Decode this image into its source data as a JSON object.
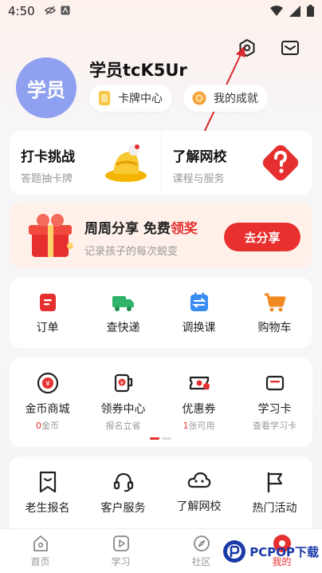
{
  "status_bar": {
    "time": "4:50"
  },
  "profile": {
    "avatar_text": "学员",
    "username": "学员tcK5Ur",
    "pills": [
      {
        "label": "卡牌中心",
        "icon": "card-icon"
      },
      {
        "label": "我的成就",
        "icon": "medal-icon"
      }
    ]
  },
  "header_icons": [
    "settings-icon",
    "message-icon"
  ],
  "promo": [
    {
      "title": "打卡挑战",
      "subtitle": "答题抽卡牌"
    },
    {
      "title": "了解网校",
      "subtitle": "课程与服务"
    }
  ],
  "share": {
    "title_part1": "周周分享 免费",
    "title_highlight": "领奖",
    "subtitle": "记录孩子的每次蜕变",
    "button": "去分享"
  },
  "orders_row": [
    {
      "label": "订单",
      "icon": "order-icon"
    },
    {
      "label": "查快递",
      "icon": "truck-icon"
    },
    {
      "label": "调换课",
      "icon": "swap-course-icon"
    },
    {
      "label": "购物车",
      "icon": "cart-icon"
    }
  ],
  "wallet_row": [
    {
      "label": "金币商城",
      "sub_num": "0",
      "sub_text": "金币",
      "icon": "coin-icon"
    },
    {
      "label": "领券中心",
      "sub_text": "报名立省",
      "icon": "coupon-cup-icon"
    },
    {
      "label": "优惠券",
      "sub_num": "1",
      "sub_text": "张可用",
      "icon": "ticket-icon"
    },
    {
      "label": "学习卡",
      "sub_text": "查看学习卡",
      "icon": "study-card-icon"
    }
  ],
  "service_row": [
    {
      "label": "老生报名",
      "icon": "bookmark-heart-icon"
    },
    {
      "label": "客户服务",
      "icon": "headset-icon"
    },
    {
      "label": "了解网校",
      "icon": "cloud-face-icon"
    },
    {
      "label": "热门活动",
      "icon": "flag-icon"
    }
  ],
  "bottom_nav": [
    {
      "label": "首页",
      "icon": "home-icon"
    },
    {
      "label": "学习",
      "icon": "play-icon"
    },
    {
      "label": "社区",
      "icon": "compass-icon"
    },
    {
      "label": "我的",
      "icon": "profile-icon",
      "active": true
    }
  ],
  "watermark": "PCPOP下载",
  "colors": {
    "accent": "#e5302f",
    "avatar": "#8fa0f0",
    "banner_bg": "#fff1ea"
  }
}
